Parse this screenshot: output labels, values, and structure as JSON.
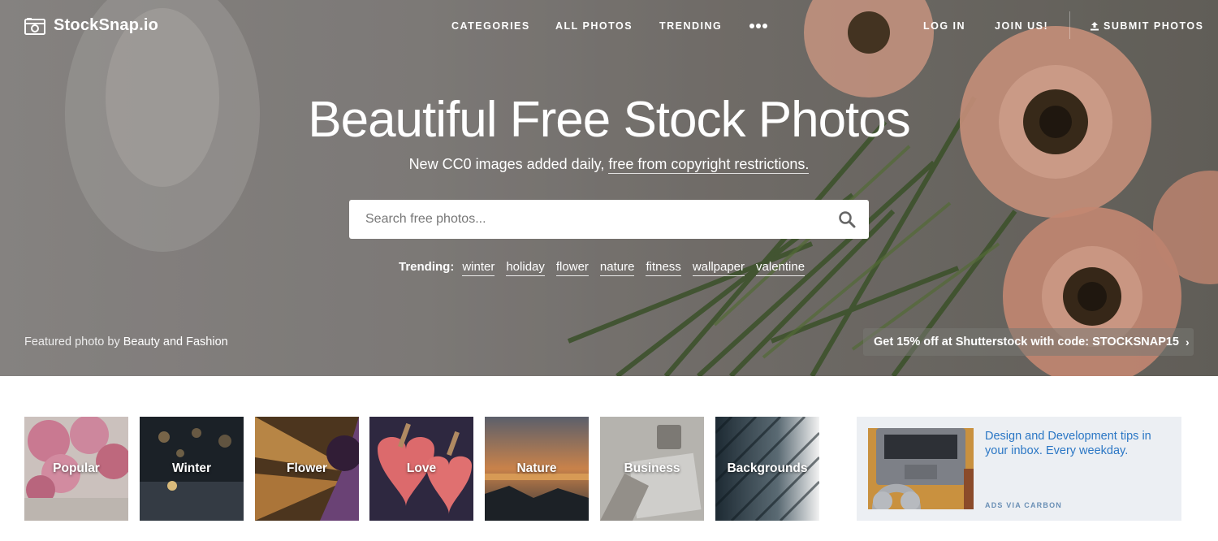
{
  "brand": {
    "name": "StockSnap.io"
  },
  "nav": {
    "categories": "CATEGORIES",
    "all_photos": "ALL PHOTOS",
    "trending": "TRENDING",
    "log_in": "LOG IN",
    "join": "JOIN US!",
    "submit": "SUBMIT PHOTOS"
  },
  "hero": {
    "title": "Beautiful Free Stock Photos",
    "subtitle_prefix": "New CC0 images added daily, ",
    "subtitle_link": "free from copyright restrictions."
  },
  "search": {
    "placeholder": "Search free photos..."
  },
  "trending": {
    "label": "Trending:",
    "tags": [
      "winter",
      "holiday",
      "flower",
      "nature",
      "fitness",
      "wallpaper",
      "valentine"
    ]
  },
  "featured": {
    "prefix": "Featured photo by ",
    "author": "Beauty and Fashion"
  },
  "promo": {
    "text": "Get 15% off at Shutterstock with code: STOCKSNAP15"
  },
  "categories": [
    {
      "label": "Popular"
    },
    {
      "label": "Winter"
    },
    {
      "label": "Flower"
    },
    {
      "label": "Love"
    },
    {
      "label": "Nature"
    },
    {
      "label": "Business"
    },
    {
      "label": "Backgrounds"
    }
  ],
  "ad": {
    "text": "Design and Development tips in your inbox. Every weekday.",
    "via": "ADS VIA CARBON"
  },
  "colors": {
    "ad_link": "#2b77c5",
    "ad_bg": "#eceff3"
  }
}
